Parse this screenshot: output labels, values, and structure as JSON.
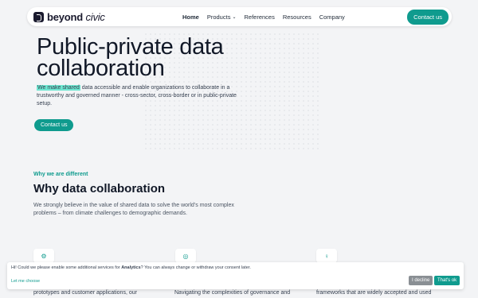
{
  "nav": {
    "brand_bold": "beyond",
    "brand_italic": "civic",
    "items": [
      {
        "label": "Home",
        "active": true,
        "dropdown": false
      },
      {
        "label": "Products",
        "active": false,
        "dropdown": true
      },
      {
        "label": "References",
        "active": false,
        "dropdown": false
      },
      {
        "label": "Resources",
        "active": false,
        "dropdown": false
      },
      {
        "label": "Company",
        "active": false,
        "dropdown": false
      }
    ],
    "cta": "Contact us"
  },
  "hero": {
    "title": "Public-private data collaboration",
    "highlight": "We make shared",
    "desc_rest": " data accessible and enable organizations to collaborate in a trustworthy and governed manner - cross-sector, cross-border or in public-private setup.",
    "cta": "Contact us"
  },
  "section": {
    "kicker": "Why we are different",
    "title": "Why data collaboration",
    "desc": "We strongly believe in the value of shared data to solve the world’s most complex problems – from climate challenges to demographic demands."
  },
  "cards": [
    {
      "icon": "network-icon",
      "glyph": "⚙",
      "text": "prototypes and customer applications, our"
    },
    {
      "icon": "globe-icon",
      "glyph": "◎",
      "text": "Navigating the complexities of governance and"
    },
    {
      "icon": "lightbulb-icon",
      "glyph": "♀",
      "text": "frameworks that are widely accepted and used"
    }
  ],
  "consent": {
    "msg_prefix": "Hi! Could we please enable some additional services for ",
    "msg_bold": "Analytics",
    "msg_suffix": "? You can always change or withdraw your consent later.",
    "link": "Let me choose",
    "decline": "I decline",
    "accept": "That's ok"
  },
  "colors": {
    "accent": "#0f9b8e",
    "highlight": "#6ee7d1",
    "decline": "#8a8f94"
  }
}
